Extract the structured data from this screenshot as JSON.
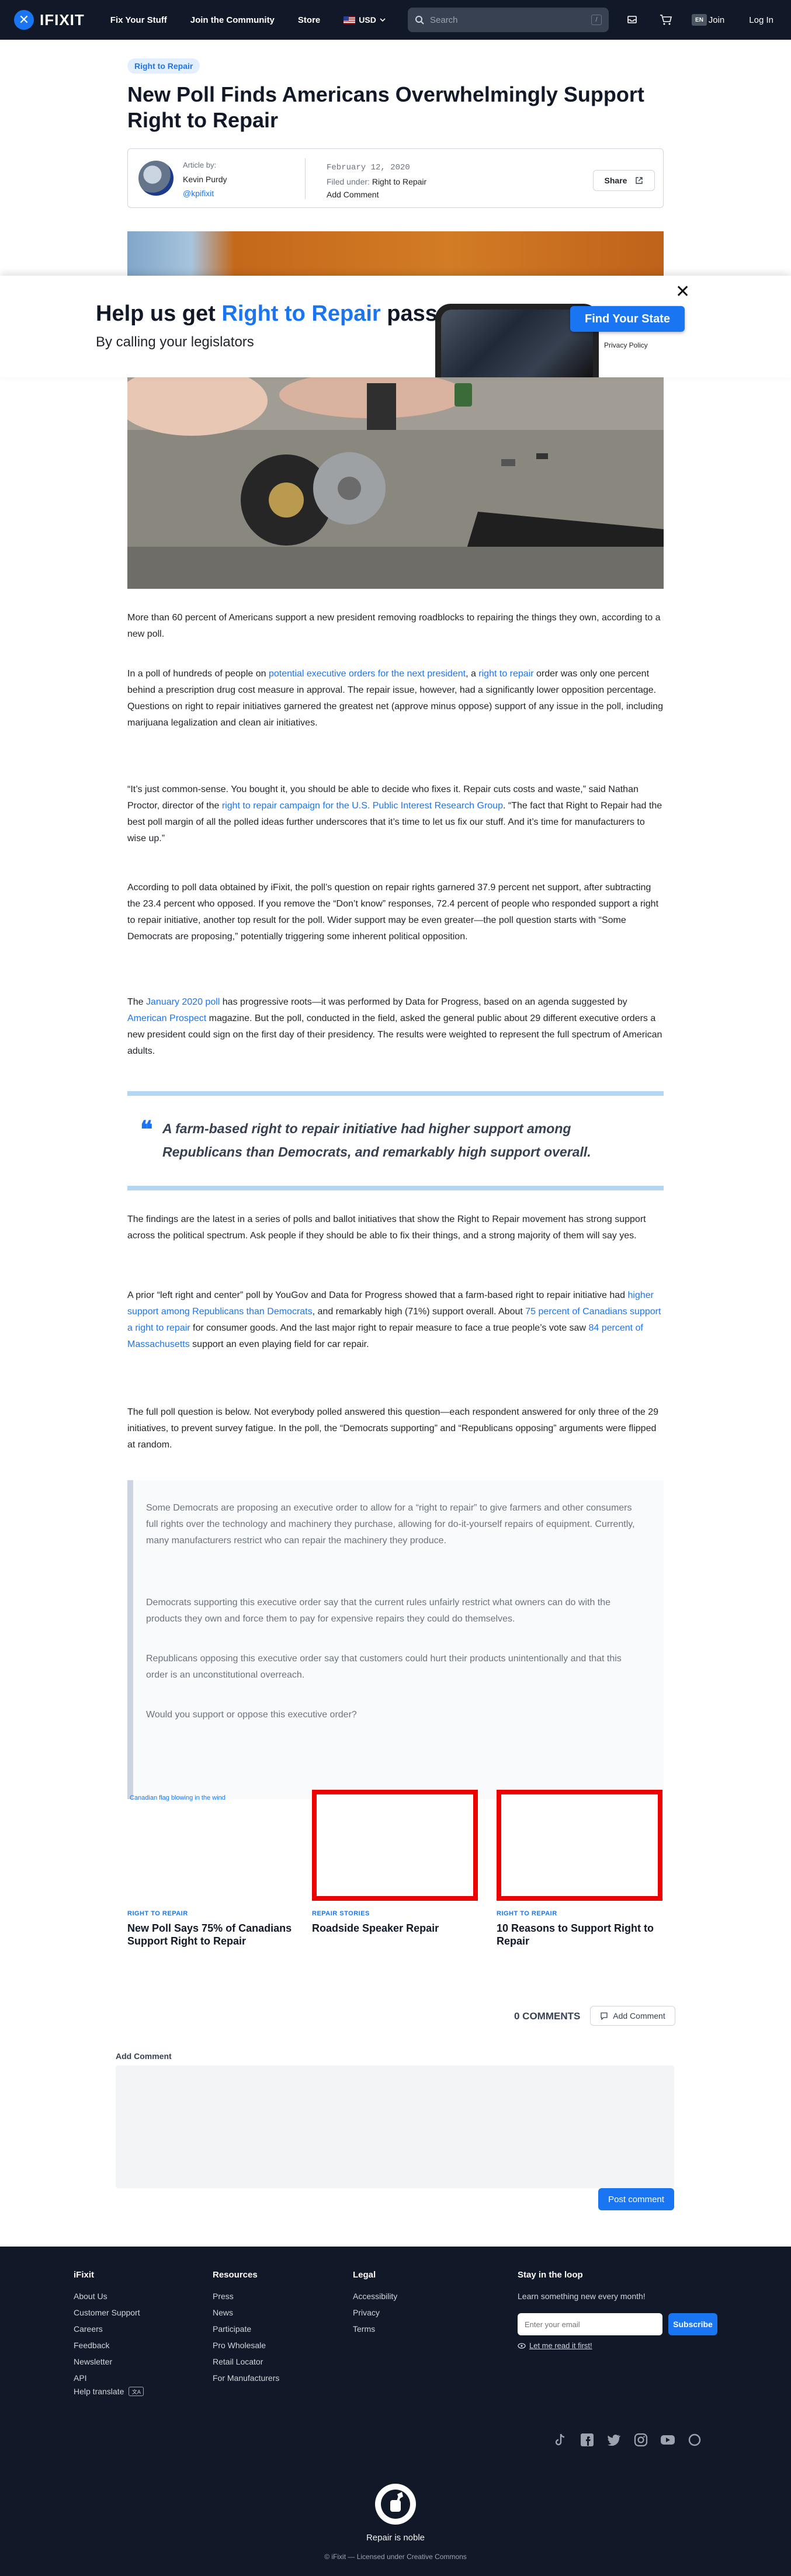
{
  "nav": {
    "logo": "IFIXIT",
    "links": [
      "Fix Your Stuff",
      "Join the Community",
      "Store"
    ],
    "currency": "USD",
    "search_placeholder": "Search",
    "search_key": "/",
    "lang": "EN",
    "join": "Join",
    "login": "Log In"
  },
  "article": {
    "tag": "Right to Repair",
    "title_line1": "New Poll Finds Americans Overwhelmingly Support",
    "title_line2": "Right to Repair",
    "author_label": "Article by:",
    "author_name": "Kevin Purdy",
    "author_handle": "@kpifixit",
    "date": "February 12, 2020",
    "filed_label": "Filed under:",
    "filed_link": "Right to Repair",
    "add_comment": "Add Comment",
    "share": "Share"
  },
  "banner": {
    "title_pre": "Help us get ",
    "title_highlight": "Right to Repair",
    "title_post": " passed",
    "subtitle": "By calling your legislators",
    "button": "Find Your State",
    "privacy": "Privacy Policy",
    "close": "✕"
  },
  "body": {
    "p1": "More than 60 percent of Americans support a new president removing roadblocks to repairing the things they own, according to a new poll.",
    "p2a": "In a poll of hundreds of people on ",
    "p2_link1": "potential executive orders for the next president",
    "p2b": ", a ",
    "p2_link2": "right to repair",
    "p2c": " order was only one percent behind a prescription drug cost measure in approval. The repair issue, however, had a significantly lower opposition percentage. Questions on right to repair initiatives garnered the greatest net (approve minus oppose) support of any issue in the poll, including marijuana legalization and clean air initiatives.",
    "p3a": "“It’s just common-sense. You bought it, you should be able to decide who fixes it. Repair cuts costs and waste,” said Nathan Proctor, director of the ",
    "p3_link": "right to repair campaign for the U.S. Public Interest Research Group",
    "p3b": ". “The fact that Right to Repair had the best poll margin of all the polled ideas further underscores that it’s time to let us fix our stuff. And it’s time for manufacturers to wise up.”",
    "p4": "According to poll data obtained by iFixit, the poll’s question on repair rights garnered 37.9 percent net support, after subtracting the 23.4 percent who opposed. If you remove the “Don’t know” responses, 72.4 percent of people who responded support a right to repair initiative, another top result for the poll. Wider support may be even greater—the poll question starts with “Some Democrats are proposing,” potentially triggering some inherent political opposition.",
    "p5a": "The ",
    "p5_link1": "January 2020 poll",
    "p5b": " has progressive roots—it was performed by Data for Progress, based on an agenda suggested by ",
    "p5_link2": "American Prospect",
    "p5c": " magazine. But the poll, conducted in the field, asked the general public about 29 different executive orders a new president could sign on the first day of their presidency. The results were weighted to represent the full spectrum of American adults.",
    "quote_mark": "❝",
    "quote": "A farm-based right to repair initiative had higher support among Republicans than Democrats, and remarkably high support overall.",
    "p6": "The findings are the latest in a series of polls and ballot initiatives that show the Right to Repair movement has strong support across the political spectrum. Ask people if they should be able to fix their things, and a strong majority of them will say yes.",
    "p7a": "A prior “left right and center” poll by YouGov and Data for Progress showed that a farm-based right to repair initiative had ",
    "p7_link1": "higher support among Republicans than Democrats",
    "p7b": ", and remarkably high (71%) support overall. About ",
    "p7_link2": "75 percent of Canadians support a right to repair",
    "p7c": " for consumer goods. And the last major right to repair measure to face a true people’s vote saw ",
    "p7_link3": "84 percent of Massachusetts",
    "p7d": " support an even playing field for car repair.",
    "p8": "The full poll question is below. Not everybody polled answered this question—each respondent answered for only three of the 29 initiatives, to prevent survey fatigue. In the poll, the “Democrats supporting” and “Republicans opposing” arguments were flipped at random.",
    "bq1": "Some Democrats are proposing an executive order to allow for a “right to repair” to give farmers and other consumers full rights over the technology and machinery they purchase, allowing for do-it-yourself repairs of equipment. Currently, many manufacturers restrict who can repair the machinery they produce.",
    "bq2": "Democrats supporting this executive order say that the current rules unfairly restrict what owners can do with the products they own and force them to pay for expensive repairs they could do themselves.",
    "bq3": "Republicans opposing this executive order say that customers could hurt their products unintentionally and that this order is an unconstitutional overreach.",
    "bq4": "Would you support or oppose this executive order?"
  },
  "related": [
    {
      "alt": "Canadian flag blowing in the wind",
      "tag": "RIGHT TO REPAIR",
      "title": "New Poll Says 75% of Canadians Support Right to Repair"
    },
    {
      "tag": "REPAIR STORIES",
      "title": "Roadside Speaker Repair"
    },
    {
      "tag": "RIGHT TO REPAIR",
      "title": "10 Reasons to Support Right to Repair"
    }
  ],
  "comments": {
    "count": "0 COMMENTS",
    "add_button": "Add Comment",
    "heading": "Add Comment",
    "post": "Post comment"
  },
  "footer": {
    "col1_title": "iFixit",
    "col1": [
      "About Us",
      "Customer Support",
      "Careers",
      "Feedback",
      "Newsletter",
      "API"
    ],
    "col2_title": "Resources",
    "col2": [
      "Press",
      "News",
      "Participate",
      "Pro Wholesale",
      "Retail Locator",
      "For Manufacturers"
    ],
    "col3_title": "Legal",
    "col3": [
      "Accessibility",
      "Privacy",
      "Terms"
    ],
    "loop_title": "Stay in the loop",
    "loop_sub": "Learn something new every month!",
    "email_placeholder": "Enter your email",
    "subscribe": "Subscribe",
    "read_first": "Let me read it first!",
    "help_translate": "Help translate",
    "tagline": "Repair is noble",
    "copyright": "© iFixit — Licensed under Creative Commons"
  }
}
